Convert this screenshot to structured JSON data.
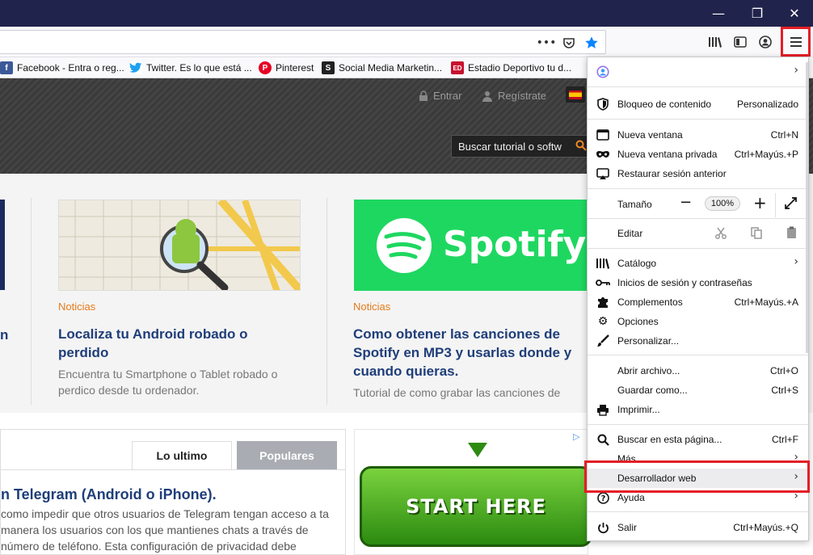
{
  "window": {
    "controls": {
      "minimize": "—",
      "maximize": "❐",
      "close": "✕"
    }
  },
  "toolbar": {
    "page_actions_icon": "more-icon",
    "pocket_icon": "pocket-icon",
    "bookmark_star_icon": "star-icon",
    "library_icon": "library-icon",
    "sidebar_icon": "sidebar-icon",
    "account_icon": "account-icon",
    "menu_icon": "hamburger-icon"
  },
  "bookmarks": [
    {
      "label": "Facebook - Entra o reg...",
      "fav": "f",
      "color": "#3b5998"
    },
    {
      "label": "Twitter. Es lo que está ...",
      "fav": "t",
      "color": "#1da1f2"
    },
    {
      "label": "Pinterest",
      "fav": "P",
      "color": "#e60023"
    },
    {
      "label": "Social Media Marketin...",
      "fav": "S",
      "color": "#222222"
    },
    {
      "label": "Estadio Deportivo tu d...",
      "fav": "ED",
      "color": "#c8102e"
    }
  ],
  "site": {
    "login": "Entrar",
    "register": "Regístrate",
    "search_placeholder": "Buscar tutorial o softw",
    "cards": [
      {
        "category": "Noticias",
        "title": "Localiza tu Android robado o perdido",
        "desc": "Encuentra tu Smartphone o Tablet robado o perdico desde tu ordenador."
      },
      {
        "category": "Noticias",
        "title": "Como obtener las canciones de Spotify en MP3 y usarlas donde y cuando quieras.",
        "desc": "Tutorial de como grabar las canciones de"
      }
    ],
    "spotify_logo": "Spotify",
    "left_title_fragment": "n",
    "tabs": {
      "latest": "Lo ultimo",
      "popular": "Populares"
    },
    "article": {
      "title": "n Telegram (Android o iPhone).",
      "text": "como impedir que otros usuarios de Telegram tengan acceso a ta manera los usuarios con los que mantienes chats a través de número de teléfono. Esta configuración de privacidad debe"
    },
    "ad": {
      "button": "START HERE"
    }
  },
  "menu": {
    "account": {
      "icon": "account-icon"
    },
    "content_blocking": {
      "label": "Bloqueo de contenido",
      "value": "Personalizado"
    },
    "new_window": {
      "label": "Nueva ventana",
      "shortcut": "Ctrl+N"
    },
    "private_window": {
      "label": "Nueva ventana privada",
      "shortcut": "Ctrl+Mayús.+P"
    },
    "restore_session": {
      "label": "Restaurar sesión anterior"
    },
    "zoom": {
      "label": "Tamaño",
      "value": "100%",
      "minus": "−",
      "plus": "+"
    },
    "edit": {
      "label": "Editar"
    },
    "library": {
      "label": "Catálogo"
    },
    "logins": {
      "label": "Inicios de sesión y contraseñas"
    },
    "addons": {
      "label": "Complementos",
      "shortcut": "Ctrl+Mayús.+A"
    },
    "options": {
      "label": "Opciones"
    },
    "customize": {
      "label": "Personalizar..."
    },
    "open_file": {
      "label": "Abrir archivo...",
      "shortcut": "Ctrl+O"
    },
    "save_as": {
      "label": "Guardar como...",
      "shortcut": "Ctrl+S"
    },
    "print": {
      "label": "Imprimir..."
    },
    "find": {
      "label": "Buscar en esta página...",
      "shortcut": "Ctrl+F"
    },
    "more": {
      "label": "Más"
    },
    "web_developer": {
      "label": "Desarrollador web"
    },
    "help": {
      "label": "Ayuda"
    },
    "exit": {
      "label": "Salir",
      "shortcut": "Ctrl+Mayús.+Q"
    }
  },
  "colors": {
    "titlebar": "#20234b",
    "highlight": "#e41e26",
    "link": "#1f3e79",
    "accent": "#e47c1c"
  }
}
